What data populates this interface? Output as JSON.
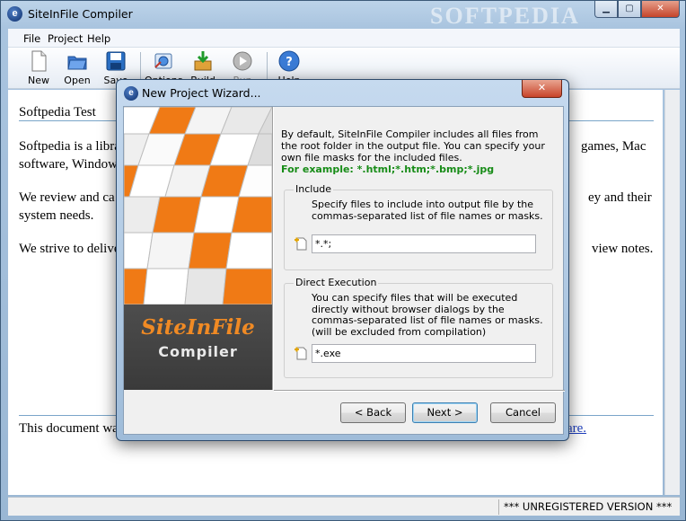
{
  "app": {
    "title": "SiteInFile Compiler",
    "watermark": "SOFTPEDIA",
    "icon_letter": "e"
  },
  "menu": [
    "File",
    "Project",
    "Help"
  ],
  "toolbar": [
    {
      "label": "New",
      "icon": "new-document-icon"
    },
    {
      "label": "Open",
      "icon": "open-folder-icon"
    },
    {
      "label": "Save",
      "icon": "save-disk-icon"
    },
    {
      "label": "Options",
      "icon": "options-icon"
    },
    {
      "label": "Build",
      "icon": "build-icon"
    },
    {
      "label": "Run",
      "icon": "run-icon"
    },
    {
      "label": "Help",
      "icon": "help-icon"
    }
  ],
  "document": {
    "heading": "Softpedia Test",
    "para1_line1_left": "Softpedia is a libra",
    "para1_line1_right": "games, Mac",
    "para1_line2": "software, Window",
    "para2_line1_left": "We review and ca",
    "para2_line1_right": "ey and their",
    "para2_line2": "system needs.",
    "para3_left": "We strive to delive",
    "para3_right": "view notes.",
    "footer_left": "This document was",
    "footer_link": "are."
  },
  "status": {
    "registration": "*** UNREGISTERED VERSION ***"
  },
  "dialog": {
    "title": "New Project Wizard...",
    "close_glyph": "✕",
    "brand_line1": "SiteInFile",
    "brand_line2": "Compiler",
    "intro": "By default, SiteInFile Compiler includes all files from the root folder in the output file. You can specify your own file masks for the included files.",
    "example": "For example: *.html;*.htm;*.bmp;*.jpg",
    "include": {
      "label": "Include",
      "description": "Specify files to include into output file by the commas-separated list of file names or masks.",
      "value": "*.*;"
    },
    "direct_execution": {
      "label": "Direct Execution",
      "description": "You can specify files that will be executed directly without browser dialogs by the commas-separated list of file names or masks. (will be excluded from compilation)",
      "value": "*.exe"
    },
    "buttons": {
      "back": "< Back",
      "next": "Next >",
      "cancel": "Cancel"
    }
  },
  "colors": {
    "accent_orange": "#f08a24",
    "example_green": "#178c17",
    "link_blue": "#1f3fbf"
  }
}
